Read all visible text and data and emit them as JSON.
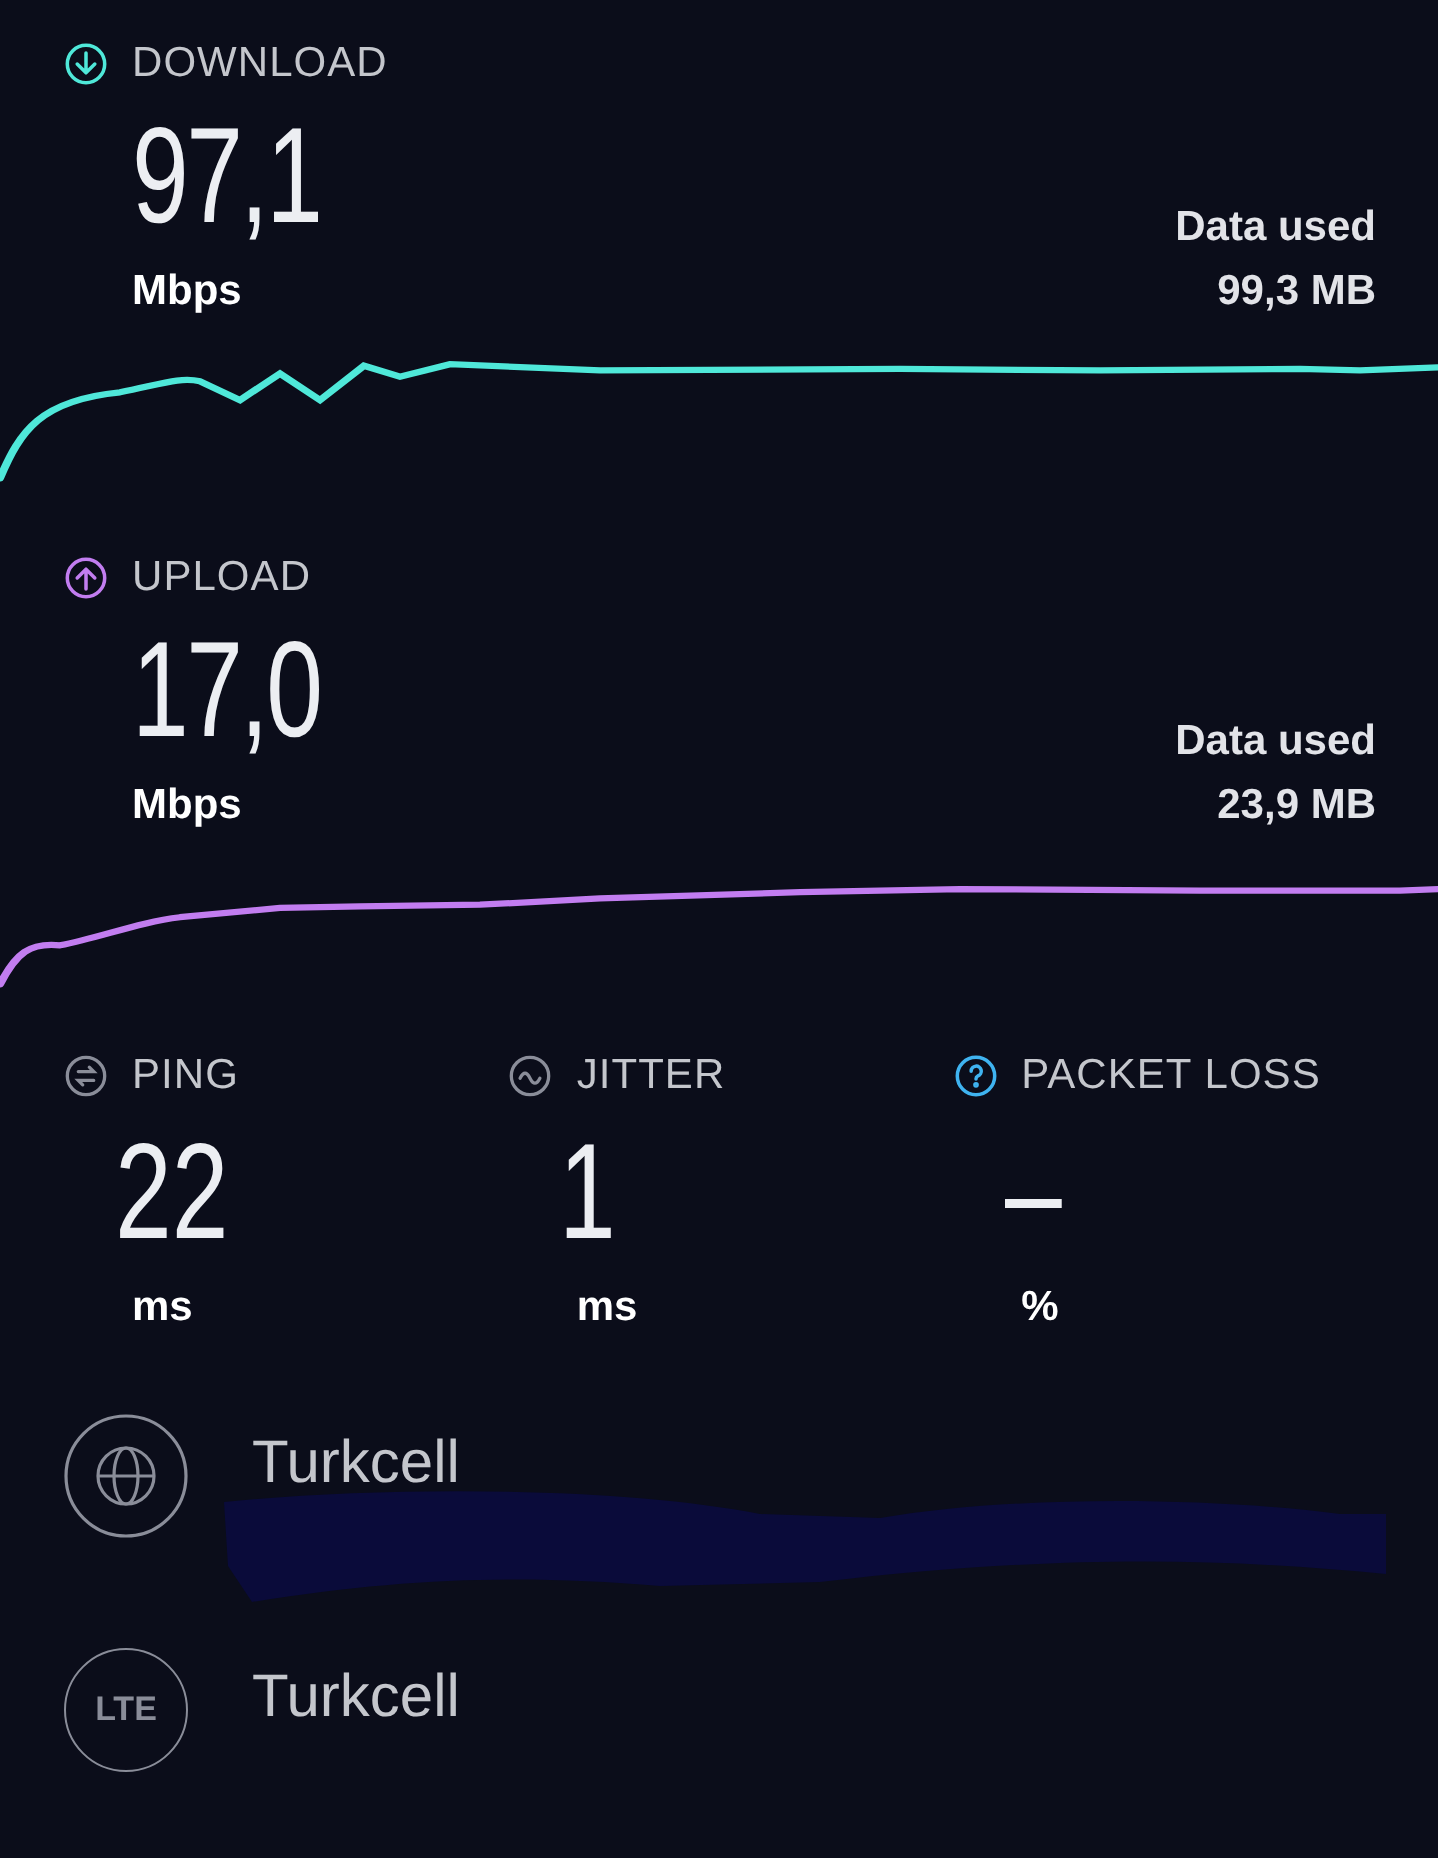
{
  "speeds": [
    {
      "kind": "download",
      "label": "DOWNLOAD",
      "value": "97,1",
      "unit": "Mbps",
      "data_used_label": "Data used",
      "data_used": "99,3 MB",
      "color": "#4fe8d9"
    },
    {
      "kind": "upload",
      "label": "UPLOAD",
      "value": "17,0",
      "unit": "Mbps",
      "data_used_label": "Data used",
      "data_used": "23,9 MB",
      "color": "#c27df0"
    }
  ],
  "metrics": [
    {
      "kind": "ping",
      "label": "PING",
      "value": "22",
      "unit": "ms"
    },
    {
      "kind": "jitter",
      "label": "JITTER",
      "value": "1",
      "unit": "ms"
    },
    {
      "kind": "packet_loss",
      "label": "PACKET LOSS",
      "value": "–",
      "unit": "%"
    }
  ],
  "providers": [
    {
      "kind": "globe",
      "name": "Turkcell",
      "redacted": true
    },
    {
      "kind": "lte",
      "icon_text": "LTE",
      "name": "Turkcell",
      "redacted": false
    }
  ]
}
